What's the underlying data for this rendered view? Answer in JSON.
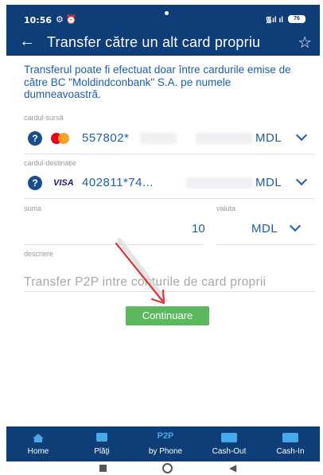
{
  "status_bar": {
    "time": "10:56",
    "left_icons": "⚙ ⏰",
    "signal": "᯾ıl ıl",
    "battery": "76"
  },
  "header": {
    "title": "Transfer către un alt card propriu"
  },
  "info_text": "Transferul poate fi efectuat doar între cardurile emise de către BC \"Moldindconbank\" S.A. pe numele dumneavoastră.",
  "source_card": {
    "label": "cardul-sursă",
    "number": "557802*",
    "currency": "MDL",
    "brand": "mastercard"
  },
  "destination_card": {
    "label": "cardul-destinație",
    "number": "402811*74...",
    "currency": "MDL",
    "brand": "VISA"
  },
  "amount": {
    "label": "suma",
    "value": "10"
  },
  "currency_field": {
    "label": "valuta",
    "value": "MDL"
  },
  "description": {
    "label": "descriere",
    "value": "Transfer P2P intre conturile de card proprii"
  },
  "continue_label": "Continuare",
  "bottom_nav": [
    {
      "label": "Home",
      "icon": "home-icon"
    },
    {
      "label": "Plăţi",
      "icon": "wallet-icon"
    },
    {
      "label": "by Phone",
      "icon": "p2p-icon",
      "icon_text": "P2P"
    },
    {
      "label": "Cash-Out",
      "icon": "cash-out-icon"
    },
    {
      "label": "Cash-In",
      "icon": "cash-in-icon"
    }
  ],
  "colors": {
    "primary": "#0e3d78",
    "accent_text": "#1f5ea8",
    "button": "#5cb85c",
    "nav_icon": "#48a8e8"
  }
}
